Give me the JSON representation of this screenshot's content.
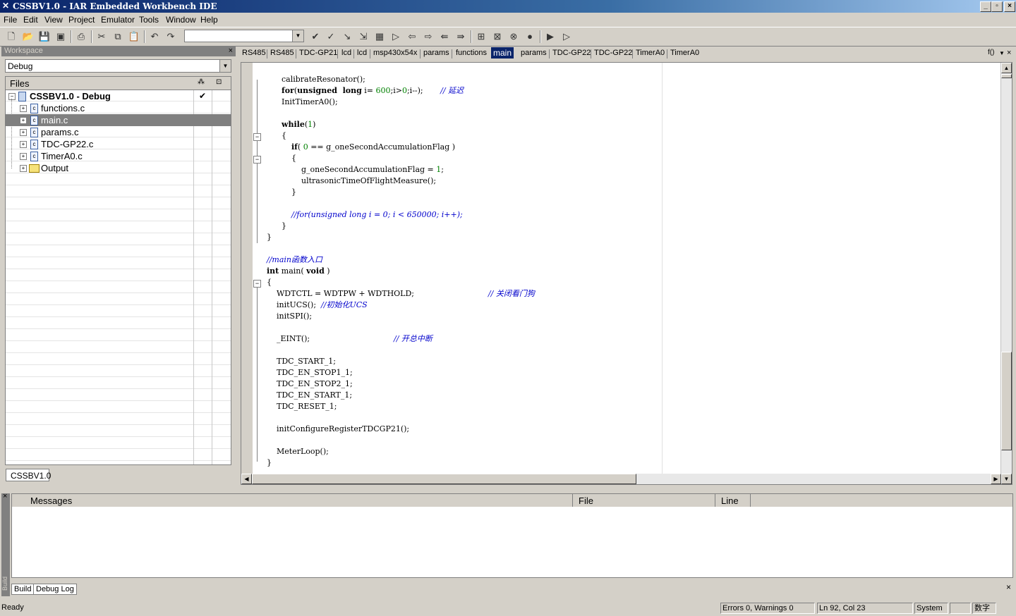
{
  "window": {
    "title": "CSSBV1.0 - IAR Embedded Workbench IDE"
  },
  "menu": [
    "File",
    "Edit",
    "View",
    "Project",
    "Emulator",
    "Tools",
    "Window",
    "Help"
  ],
  "toolbar": {
    "search_value": ""
  },
  "workspace": {
    "header": "Workspace",
    "config": "Debug",
    "files_header": "Files",
    "tab": "CSSBV1.0",
    "tree": [
      {
        "label": "CSSBV1.0 - Debug",
        "type": "project",
        "selected": false,
        "checked": true
      },
      {
        "label": "functions.c",
        "type": "file",
        "selected": false
      },
      {
        "label": "main.c",
        "type": "file",
        "selected": true
      },
      {
        "label": "params.c",
        "type": "file",
        "selected": false
      },
      {
        "label": "TDC-GP22.c",
        "type": "file",
        "selected": false
      },
      {
        "label": "TimerA0.c",
        "type": "file",
        "selected": false
      },
      {
        "label": "Output",
        "type": "folder",
        "selected": false
      }
    ]
  },
  "editor": {
    "tabs": [
      "RS485",
      "RS485",
      "TDC-GP21",
      "lcd",
      "lcd",
      "msp430x54x",
      "params",
      "functions",
      "main",
      "params",
      "TDC-GP22",
      "TDC-GP22",
      "TimerA0",
      "TimerA0"
    ],
    "active_tab": 8,
    "tab_menu": "f()",
    "code": [
      {
        "indent": 3,
        "parts": [
          [
            "t",
            "calibrateResonator();"
          ]
        ]
      },
      {
        "indent": 3,
        "parts": [
          [
            "k",
            "for"
          ],
          [
            "t",
            "("
          ],
          [
            "k",
            "unsigned  long"
          ],
          [
            "t",
            " i= "
          ],
          [
            "n",
            "600"
          ],
          [
            "t",
            ";i>"
          ],
          [
            "n",
            "0"
          ],
          [
            "t",
            ";i--);       "
          ],
          [
            "c",
            "// 延迟"
          ]
        ]
      },
      {
        "indent": 3,
        "parts": [
          [
            "t",
            "InitTimerA0();"
          ]
        ]
      },
      {
        "indent": 3,
        "parts": [
          [
            "t",
            ""
          ]
        ]
      },
      {
        "indent": 3,
        "parts": [
          [
            "k",
            "while"
          ],
          [
            "t",
            "("
          ],
          [
            "n",
            "1"
          ],
          [
            "t",
            ")"
          ]
        ]
      },
      {
        "indent": 3,
        "parts": [
          [
            "t",
            "{"
          ]
        ]
      },
      {
        "indent": 5,
        "parts": [
          [
            "k",
            "if"
          ],
          [
            "t",
            "( "
          ],
          [
            "n",
            "0"
          ],
          [
            "t",
            " == g_oneSecondAccumulationFlag )"
          ]
        ]
      },
      {
        "indent": 5,
        "parts": [
          [
            "t",
            "{"
          ]
        ]
      },
      {
        "indent": 7,
        "parts": [
          [
            "t",
            "g_oneSecondAccumulationFlag = "
          ],
          [
            "n",
            "1"
          ],
          [
            "t",
            ";"
          ]
        ]
      },
      {
        "indent": 7,
        "parts": [
          [
            "t",
            "ultrasonicTimeOfFlightMeasure();"
          ]
        ]
      },
      {
        "indent": 5,
        "parts": [
          [
            "t",
            "}"
          ]
        ]
      },
      {
        "indent": 5,
        "parts": [
          [
            "t",
            ""
          ]
        ]
      },
      {
        "indent": 5,
        "parts": [
          [
            "c",
            "//for(unsigned long i = 0; i < 650000; i++);"
          ]
        ]
      },
      {
        "indent": 3,
        "parts": [
          [
            "t",
            "}"
          ]
        ]
      },
      {
        "indent": 0,
        "parts": [
          [
            "t",
            "}"
          ]
        ]
      },
      {
        "indent": 0,
        "parts": [
          [
            "t",
            ""
          ]
        ]
      },
      {
        "indent": 0,
        "parts": [
          [
            "c",
            "//main函数入口"
          ]
        ]
      },
      {
        "indent": 0,
        "parts": [
          [
            "k",
            "int"
          ],
          [
            "t",
            " main( "
          ],
          [
            "k",
            "void"
          ],
          [
            "t",
            " )"
          ]
        ]
      },
      {
        "indent": 0,
        "parts": [
          [
            "t",
            "{"
          ]
        ]
      },
      {
        "indent": 2,
        "parts": [
          [
            "t",
            "WDTCTL = WDTPW + WDTHOLD;                              "
          ],
          [
            "c",
            "// 关闭看门狗"
          ]
        ]
      },
      {
        "indent": 2,
        "parts": [
          [
            "t",
            "initUCS();  "
          ],
          [
            "c",
            "//初始化UCS"
          ]
        ]
      },
      {
        "indent": 2,
        "parts": [
          [
            "t",
            "initSPI();"
          ]
        ]
      },
      {
        "indent": 2,
        "parts": [
          [
            "t",
            ""
          ]
        ]
      },
      {
        "indent": 2,
        "parts": [
          [
            "t",
            "_EINT();                                  "
          ],
          [
            "c",
            "// 开总中断"
          ]
        ]
      },
      {
        "indent": 2,
        "parts": [
          [
            "t",
            ""
          ]
        ]
      },
      {
        "indent": 2,
        "parts": [
          [
            "t",
            "TDC_START_1;"
          ]
        ]
      },
      {
        "indent": 2,
        "parts": [
          [
            "t",
            "TDC_EN_STOP1_1;"
          ]
        ]
      },
      {
        "indent": 2,
        "parts": [
          [
            "t",
            "TDC_EN_STOP2_1;"
          ]
        ]
      },
      {
        "indent": 2,
        "parts": [
          [
            "t",
            "TDC_EN_START_1;"
          ]
        ]
      },
      {
        "indent": 2,
        "parts": [
          [
            "t",
            "TDC_RESET_1;"
          ]
        ]
      },
      {
        "indent": 2,
        "parts": [
          [
            "t",
            ""
          ]
        ]
      },
      {
        "indent": 2,
        "parts": [
          [
            "t",
            "initConfigureRegisterTDCGP21();"
          ]
        ]
      },
      {
        "indent": 2,
        "parts": [
          [
            "t",
            ""
          ]
        ]
      },
      {
        "indent": 2,
        "parts": [
          [
            "t",
            "MeterLoop();"
          ]
        ]
      },
      {
        "indent": 0,
        "parts": [
          [
            "t",
            "}"
          ]
        ]
      }
    ]
  },
  "messages": {
    "columns": [
      "Messages",
      "File",
      "Line"
    ],
    "side_label": "Build",
    "tabs": [
      "Build",
      "Debug Log"
    ]
  },
  "status": {
    "ready": "Ready",
    "errors": "Errors 0, Warnings 0",
    "position": "Ln 92, Col 23",
    "encoding": "System",
    "blank": "",
    "ime": "数字"
  }
}
